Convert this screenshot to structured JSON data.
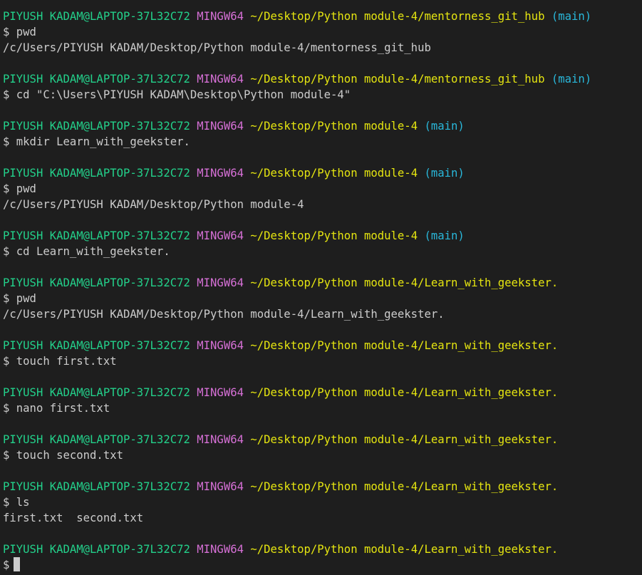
{
  "terminal": {
    "user_host": "PIYUSH KADAM@LAPTOP-37L32C72",
    "system": "MINGW64",
    "entries": [
      {
        "path": "~/Desktop/Python module-4/mentorness_git_hub",
        "branch": "(main)",
        "command": "$ pwd",
        "output": [
          "/c/Users/PIYUSH KADAM/Desktop/Python module-4/mentorness_git_hub"
        ]
      },
      {
        "path": "~/Desktop/Python module-4/mentorness_git_hub",
        "branch": "(main)",
        "command": "$ cd \"C:\\Users\\PIYUSH KADAM\\Desktop\\Python module-4\"",
        "output": []
      },
      {
        "path": "~/Desktop/Python module-4",
        "branch": "(main)",
        "command": "$ mkdir Learn_with_geekster.",
        "output": []
      },
      {
        "path": "~/Desktop/Python module-4",
        "branch": "(main)",
        "command": "$ pwd",
        "output": [
          "/c/Users/PIYUSH KADAM/Desktop/Python module-4"
        ]
      },
      {
        "path": "~/Desktop/Python module-4",
        "branch": "(main)",
        "command": "$ cd Learn_with_geekster.",
        "output": []
      },
      {
        "path": "~/Desktop/Python module-4/Learn_with_geekster.",
        "branch": "",
        "command": "$ pwd",
        "output": [
          "/c/Users/PIYUSH KADAM/Desktop/Python module-4/Learn_with_geekster."
        ]
      },
      {
        "path": "~/Desktop/Python module-4/Learn_with_geekster.",
        "branch": "",
        "command": "$ touch first.txt",
        "output": []
      },
      {
        "path": "~/Desktop/Python module-4/Learn_with_geekster.",
        "branch": "",
        "command": "$ nano first.txt",
        "output": []
      },
      {
        "path": "~/Desktop/Python module-4/Learn_with_geekster.",
        "branch": "",
        "command": "$ touch second.txt",
        "output": []
      },
      {
        "path": "~/Desktop/Python module-4/Learn_with_geekster.",
        "branch": "",
        "command": "$ ls",
        "output": [
          "first.txt  second.txt"
        ]
      }
    ],
    "current_prompt": {
      "path": "~/Desktop/Python module-4/Learn_with_geekster.",
      "branch": "",
      "input": "$"
    }
  },
  "colors": {
    "background": "#1e1e1e",
    "user_host": "#23d18b",
    "system": "#d670d6",
    "path": "#e5e510",
    "branch": "#29b8db",
    "text": "#cccccc"
  }
}
